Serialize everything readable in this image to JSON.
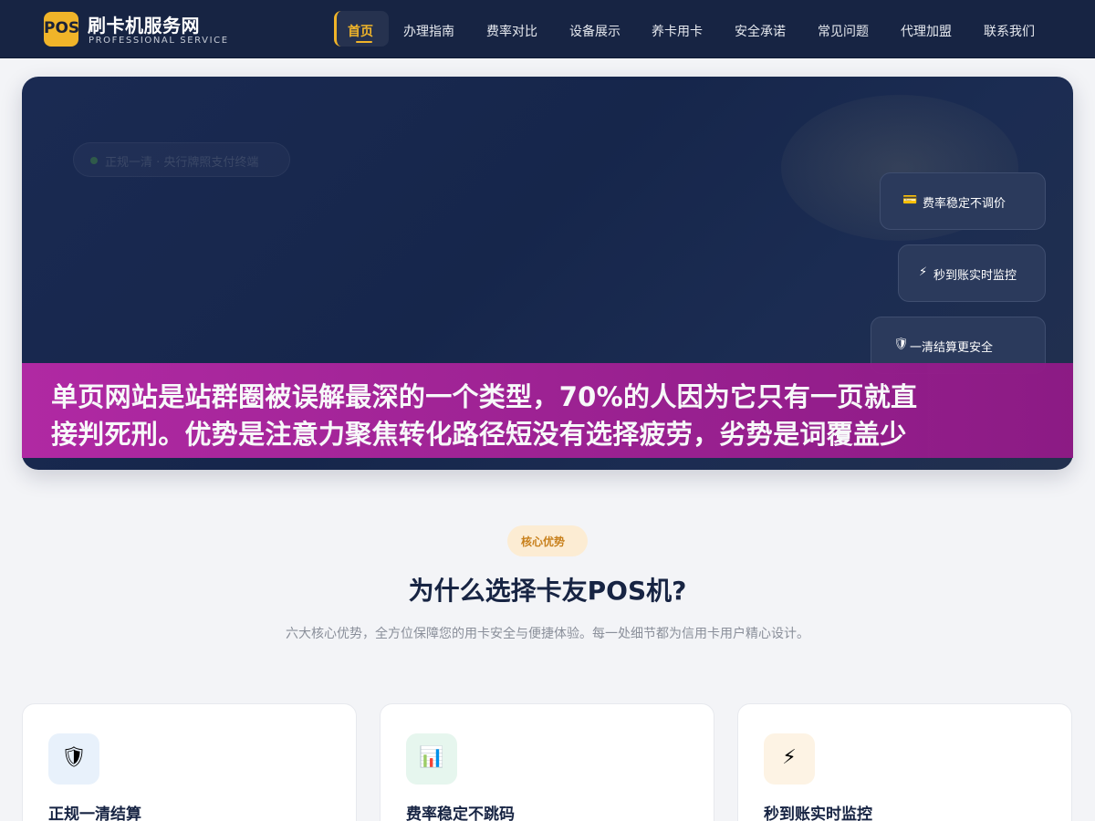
{
  "nav": {
    "logo_text": "POS",
    "brand_title": "刷卡机服务网",
    "brand_subtitle": "PROFESSIONAL SERVICE",
    "items": [
      {
        "label": "首页",
        "active": true
      },
      {
        "label": "办理指南"
      },
      {
        "label": "费率对比"
      },
      {
        "label": "设备展示"
      },
      {
        "label": "养卡用卡"
      },
      {
        "label": "安全承诺"
      },
      {
        "label": "常见问题"
      },
      {
        "label": "代理加盟"
      },
      {
        "label": "联系我们"
      }
    ]
  },
  "hero": {
    "pill_text": "正规一清 · 央行牌照支付终端",
    "features": [
      {
        "icon": "💳",
        "icon_name": "credit-card-icon",
        "label": "费率稳定不调价"
      },
      {
        "icon": "⚡",
        "icon_name": "lightning-icon",
        "label": "秒到账实时监控"
      },
      {
        "icon": "🛡",
        "icon_name": "shield-icon",
        "label": "一清结算更安全"
      }
    ]
  },
  "banner": {
    "line1": "单页网站是站群圈被误解最深的一个类型，70%的人因为它只有一页就直",
    "line2": "接判死刑。优势是注意力聚焦转化路径短没有选择疲劳，劣势是词覆盖少",
    "color_start": "#b52aa6",
    "color_end": "#8f1a86"
  },
  "section": {
    "tag": "核心优势",
    "title": "为什么选择卡友POS机?",
    "description": "六大核心优势，全方位保障您的用卡安全与便捷体验。每一处细节都为信用卡用户精心设计。",
    "cards": [
      {
        "icon": "🛡",
        "icon_name": "shield-icon",
        "title": "正规一清结算",
        "icon_bg": "#e8f1fb"
      },
      {
        "icon": "📊",
        "icon_name": "bar-chart-icon",
        "title": "费率稳定不跳码",
        "icon_bg": "#e6f6ee"
      },
      {
        "icon": "⚡",
        "icon_name": "lightning-icon",
        "title": "秒到账实时监控",
        "icon_bg": "#fdf3e4"
      }
    ]
  },
  "colors": {
    "nav_bg": "#172443",
    "accent": "#f0b429",
    "hero_bg": "#1a2a52",
    "page_bg": "#f3f4f7"
  }
}
